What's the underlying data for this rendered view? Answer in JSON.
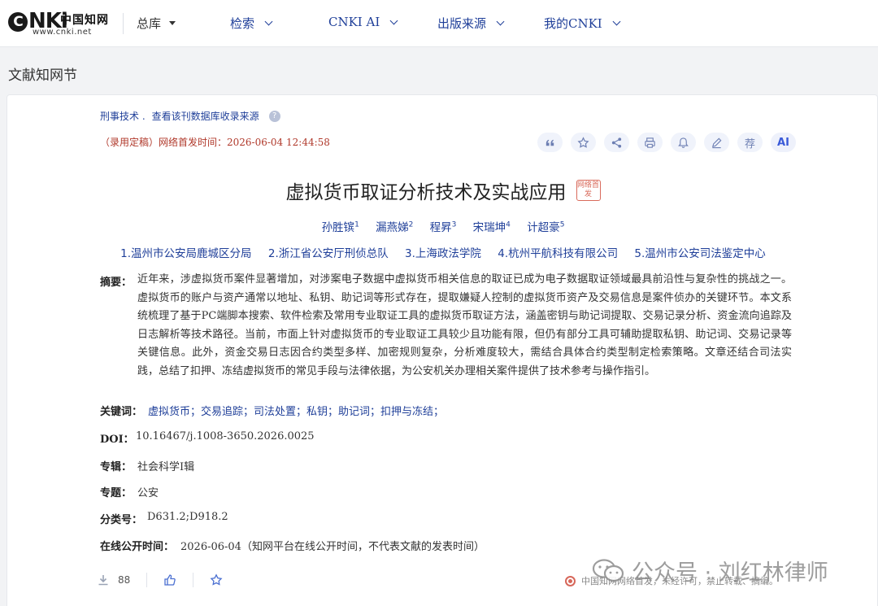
{
  "logo": {
    "brand": "CNKi",
    "cn_name": "中国知网",
    "url": "www.cnki.net"
  },
  "nav": {
    "library": "总库",
    "items": [
      "检索",
      "CNKI AI",
      "出版来源",
      "我的CNKI"
    ]
  },
  "section_title": "文献知网节",
  "article": {
    "source_journal": "刑事技术 .",
    "source_link": "查看该刊数据库收录来源",
    "publish_status": "（录用定稿）网络首发时间：2026-06-04 12:44:58",
    "tools": [
      "quote-icon",
      "star-icon",
      "share-icon",
      "print-icon",
      "bell-icon",
      "edit-icon",
      "荐",
      "AI"
    ],
    "title": "虚拟货币取证分析技术及实战应用",
    "badge": "网络首发",
    "authors": [
      {
        "name": "孙胜镔",
        "sup": "1"
      },
      {
        "name": "漏燕娣",
        "sup": "2"
      },
      {
        "name": "程昇",
        "sup": "3"
      },
      {
        "name": "宋瑞坤",
        "sup": "4"
      },
      {
        "name": "计超豪",
        "sup": "5"
      }
    ],
    "orgs": [
      "1.温州市公安局鹿城区分局",
      "2.浙江省公安厅刑侦总队",
      "3.上海政法学院",
      "4.杭州平航科技有限公司",
      "5.温州市公安司法鉴定中心"
    ],
    "abstract_label": "摘要：",
    "abstract": "近年来，涉虚拟货币案件显著增加，对涉案电子数据中虚拟货币相关信息的取证已成为电子数据取证领域最具前沿性与复杂性的挑战之一。虚拟货币的账户与资产通常以地址、私钥、助记词等形式存在，提取嫌疑人控制的虚拟货币资产及交易信息是案件侦办的关键环节。本文系统梳理了基于PC端脚本搜索、软件检索及常用专业取证工具的虚拟货币取证方法，涵盖密钥与助记词提取、交易记录分析、资金流向追踪及日志解析等技术路径。当前，市面上针对虚拟货币的专业取证工具较少且功能有限，但仍有部分工具可辅助提取私钥、助记词、交易记录等关键信息。此外，资金交易日志因合约类型多样、加密规则复杂，分析难度较大，需结合具体合约类型制定检索策略。文章还结合司法实践，总结了扣押、冻结虚拟货币的常见手段与法律依据，为公安机关办理相关案件提供了技术参考与操作指引。",
    "keywords_label": "关键词：",
    "keywords": "虚拟货币；交易追踪；司法处置；私钥；助记词；扣押与冻结；",
    "doi_label": "DOI：",
    "doi": "10.16467/j.1008-3650.2026.0025",
    "series_label": "专辑：",
    "series": "社会科学I辑",
    "topic_label": "专题：",
    "topic": "公安",
    "class_label": "分类号：",
    "class_no": "D631.2;D918.2",
    "online_label": "在线公开时间：",
    "online_time": "2026-06-04（知网平台在线公开时间，不代表文献的发表时间）",
    "downloads": "88",
    "copyright": "中国知网网络首发，未经许可，禁止转载、摘编。"
  },
  "watermark": "公众号 · 刘红林律师",
  "colors": {
    "link_blue": "#1f3f99",
    "status_red": "#b0392b",
    "badge_red": "#d96b5c"
  }
}
